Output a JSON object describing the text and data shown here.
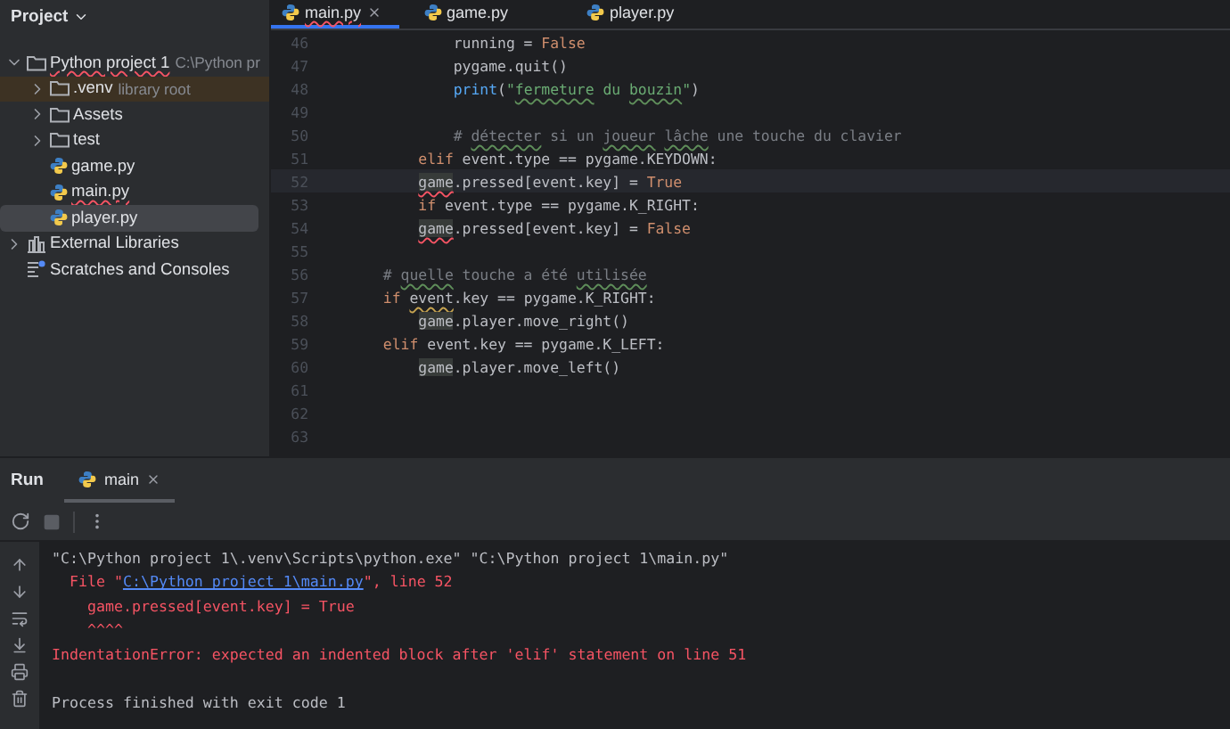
{
  "sidebar": {
    "title": "Project",
    "tree": [
      {
        "label": "Python project 1",
        "hint": "C:\\Python pr",
        "kind": "project",
        "expanded": true,
        "selected": false,
        "highlighted": false,
        "error": true,
        "children": [
          {
            "label": ".venv",
            "hint": "library root",
            "kind": "folder",
            "expanded": false,
            "selected": false,
            "highlighted": true,
            "error": false
          },
          {
            "label": "Assets",
            "kind": "folder",
            "expanded": false,
            "selected": false,
            "highlighted": false,
            "error": false
          },
          {
            "label": "test",
            "kind": "folder",
            "expanded": false,
            "selected": false,
            "highlighted": false,
            "error": false
          },
          {
            "label": "game.py",
            "kind": "python",
            "selected": false,
            "highlighted": false,
            "error": false
          },
          {
            "label": "main.py",
            "kind": "python",
            "selected": false,
            "highlighted": false,
            "error": true
          },
          {
            "label": "player.py",
            "kind": "python",
            "selected": true,
            "highlighted": false,
            "error": false
          }
        ]
      },
      {
        "label": "External Libraries",
        "kind": "library",
        "expanded": false,
        "selected": false,
        "highlighted": false,
        "error": false
      },
      {
        "label": "Scratches and Consoles",
        "kind": "scratches",
        "selected": false,
        "highlighted": false,
        "error": false
      }
    ]
  },
  "editor": {
    "tabs": [
      {
        "label": "main.py",
        "selected": true,
        "error": true,
        "closable": true
      },
      {
        "label": "game.py",
        "selected": false,
        "error": false,
        "closable": false
      },
      {
        "label": "player.py",
        "selected": false,
        "error": false,
        "closable": false
      }
    ],
    "lines": [
      {
        "number": "46",
        "current": false,
        "tokens": [
          {
            "text": "                running = ",
            "kind": "plain"
          },
          {
            "text": "False",
            "kind": "keyword"
          }
        ]
      },
      {
        "number": "47",
        "current": false,
        "tokens": [
          {
            "text": "                pygame.quit()",
            "kind": "plain"
          }
        ]
      },
      {
        "number": "48",
        "current": false,
        "tokens": [
          {
            "text": "                print",
            "kind": "builtin"
          },
          {
            "text": "(",
            "kind": "plain"
          },
          {
            "text": "\"",
            "kind": "string"
          },
          {
            "text": "fermeture",
            "kind": "string_typo"
          },
          {
            "text": " du ",
            "kind": "string"
          },
          {
            "text": "bouzin",
            "kind": "string_typo"
          },
          {
            "text": "\"",
            "kind": "string"
          },
          {
            "text": ")",
            "kind": "plain"
          }
        ]
      },
      {
        "number": "49",
        "current": false
      },
      {
        "number": "50",
        "current": false,
        "tokens": [
          {
            "text": "                # ",
            "kind": "comment"
          },
          {
            "text": "détecter",
            "kind": "comment_typo"
          },
          {
            "text": " si un ",
            "kind": "comment"
          },
          {
            "text": "joueur",
            "kind": "comment_typo"
          },
          {
            "text": " lâche",
            "kind": "comment_typo"
          },
          {
            "text": " une touche du clavier",
            "kind": "comment"
          }
        ]
      },
      {
        "number": "51",
        "current": false,
        "tokens": [
          {
            "text": "            elif",
            "kind": "keyword"
          },
          {
            "text": " event.type == pygame.KEYDOWN:",
            "kind": "plain"
          }
        ]
      },
      {
        "number": "52",
        "current": true,
        "tokens": [
          {
            "text": "            game",
            "kind": "usage_error"
          },
          {
            "text": ".pressed[event.key] = ",
            "kind": "plain"
          },
          {
            "text": "True",
            "kind": "keyword"
          }
        ]
      },
      {
        "number": "53",
        "current": false,
        "tokens": [
          {
            "text": "            if",
            "kind": "keyword"
          },
          {
            "text": " event.type == pygame.K_RIGHT:",
            "kind": "plain"
          }
        ]
      },
      {
        "number": "54",
        "current": false,
        "tokens": [
          {
            "text": "            game",
            "kind": "usage_error"
          },
          {
            "text": ".pressed[event.key] = ",
            "kind": "plain"
          },
          {
            "text": "False",
            "kind": "keyword"
          }
        ]
      },
      {
        "number": "55",
        "current": false
      },
      {
        "number": "56",
        "current": false,
        "tokens": [
          {
            "text": "        # ",
            "kind": "comment"
          },
          {
            "text": "quelle",
            "kind": "comment_typo"
          },
          {
            "text": " touche a été ",
            "kind": "comment"
          },
          {
            "text": "utilisée",
            "kind": "comment_typo"
          }
        ]
      },
      {
        "number": "57",
        "current": false,
        "tokens": [
          {
            "text": "        if",
            "kind": "keyword"
          },
          {
            "text": " event",
            "kind": "plain_warning"
          },
          {
            "text": ".key == pygame.K_RIGHT:",
            "kind": "plain"
          }
        ]
      },
      {
        "number": "58",
        "current": false,
        "tokens": [
          {
            "text": "            game",
            "kind": "usage"
          },
          {
            "text": ".player.move_right()",
            "kind": "plain"
          }
        ]
      },
      {
        "number": "59",
        "current": false,
        "tokens": [
          {
            "text": "        elif",
            "kind": "keyword"
          },
          {
            "text": " event.key == pygame.K_LEFT:",
            "kind": "plain"
          }
        ]
      },
      {
        "number": "60",
        "current": false,
        "tokens": [
          {
            "text": "            game",
            "kind": "usage"
          },
          {
            "text": ".player.move_left()",
            "kind": "plain"
          }
        ]
      },
      {
        "number": "61",
        "current": false
      },
      {
        "number": "62",
        "current": false
      },
      {
        "number": "63",
        "current": false
      }
    ]
  },
  "run_panel": {
    "title": "Run",
    "tabs": [
      {
        "label": "main",
        "selected": true
      }
    ],
    "output": [
      {
        "kind": "command",
        "tokens": [
          {
            "text": "\"C:\\Python project 1\\.venv\\Scripts\\python.exe\" \"C:\\Python project 1\\main.py\"",
            "kind": "plain"
          }
        ]
      },
      {
        "kind": "traceback",
        "tokens": [
          {
            "text": "  File \"",
            "kind": "error"
          },
          {
            "text": "C:\\Python project 1\\main.py",
            "kind": "link"
          },
          {
            "text": "\", line 52",
            "kind": "error"
          }
        ]
      },
      {
        "kind": "traceback",
        "tokens": [
          {
            "text": "    game.pressed[event.key] = True",
            "kind": "error"
          }
        ]
      },
      {
        "kind": "traceback",
        "tokens": [
          {
            "text": "    ^^^^",
            "kind": "error"
          }
        ]
      },
      {
        "kind": "traceback",
        "tokens": [
          {
            "text": "IndentationError: expected an indented block after 'elif' statement on line 51",
            "kind": "error"
          }
        ]
      },
      {
        "kind": "status",
        "tokens": [
          {
            "text": "Process finished with exit code 1",
            "kind": "plain"
          }
        ]
      }
    ]
  }
}
